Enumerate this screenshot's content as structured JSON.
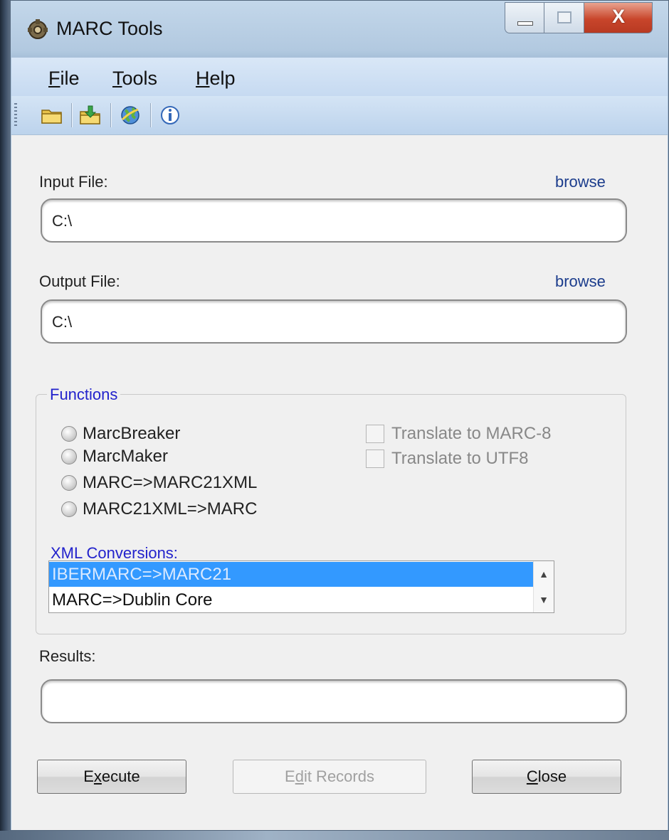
{
  "window": {
    "title": "MARC Tools",
    "close_glyph": "X"
  },
  "menu": {
    "items": [
      {
        "label": "File",
        "mnemonic": "F",
        "rest": "ile"
      },
      {
        "label": "Tools",
        "mnemonic": "T",
        "rest": "ools"
      },
      {
        "label": "Help",
        "mnemonic": "H",
        "rest": "elp"
      }
    ]
  },
  "toolbar": {
    "icons": [
      "open-folder-icon",
      "save-folder-icon",
      "globe-icon",
      "info-icon"
    ]
  },
  "input": {
    "label": "Input File:",
    "browse": "browse",
    "value": "C:\\"
  },
  "output": {
    "label": "Output File:",
    "browse": "browse",
    "value": "C:\\"
  },
  "functions": {
    "title": "Functions",
    "radios": [
      "MarcBreaker",
      "MarcMaker",
      "MARC=>MARC21XML",
      "MARC21XML=>MARC"
    ],
    "checks": [
      "Translate to MARC-8",
      "Translate to UTF8"
    ],
    "xml_label": "XML Conversions:",
    "xml_items": [
      "IBERMARC=>MARC21",
      "MARC=>Dublin Core"
    ],
    "selected_index": 0
  },
  "results": {
    "label": "Results:",
    "value": ""
  },
  "buttons": {
    "execute": {
      "pre": "E",
      "mnemonic": "x",
      "post": "ecute"
    },
    "edit_records": {
      "pre": "E",
      "mnemonic": "d",
      "post": "it Records"
    },
    "close": {
      "pre": "",
      "mnemonic": "C",
      "post": "lose"
    }
  },
  "colors": {
    "accent_blue": "#2222cc",
    "selection": "#3399ff",
    "link": "#1b3c8c"
  }
}
